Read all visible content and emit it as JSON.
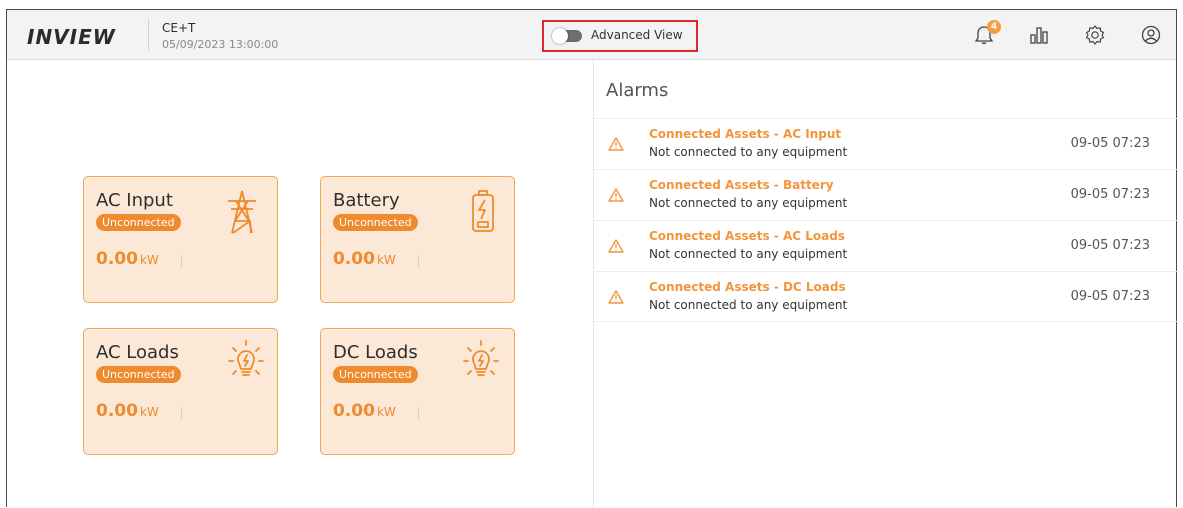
{
  "header": {
    "logo": "INVIEW",
    "site_name": "CE+T",
    "datetime": "05/09/2023 13:00:00",
    "advanced_view_label": "Advanced View",
    "advanced_view_on": false,
    "notification_count": "4"
  },
  "cards": [
    {
      "title": "AC Input",
      "status": "Unconnected",
      "value": "0.00",
      "unit": "kW",
      "icon": "power-tower-icon"
    },
    {
      "title": "Battery",
      "status": "Unconnected",
      "value": "0.00",
      "unit": "kW",
      "icon": "battery-charging-icon"
    },
    {
      "title": "AC Loads",
      "status": "Unconnected",
      "value": "0.00",
      "unit": "kW",
      "icon": "lightbulb-icon"
    },
    {
      "title": "DC Loads",
      "status": "Unconnected",
      "value": "0.00",
      "unit": "kW",
      "icon": "lightbulb-icon"
    }
  ],
  "alarms": {
    "title": "Alarms",
    "items": [
      {
        "title": "Connected Assets - AC Input",
        "description": "Not connected to any equipment",
        "time": "09-05 07:23"
      },
      {
        "title": "Connected Assets - Battery",
        "description": "Not connected to any equipment",
        "time": "09-05 07:23"
      },
      {
        "title": "Connected Assets - AC Loads",
        "description": "Not connected to any equipment",
        "time": "09-05 07:23"
      },
      {
        "title": "Connected Assets - DC Loads",
        "description": "Not connected to any equipment",
        "time": "09-05 07:23"
      }
    ]
  },
  "colors": {
    "accent": "#ef8a2e",
    "card_bg": "#fbe8d6",
    "highlight_box": "#e0262b"
  }
}
